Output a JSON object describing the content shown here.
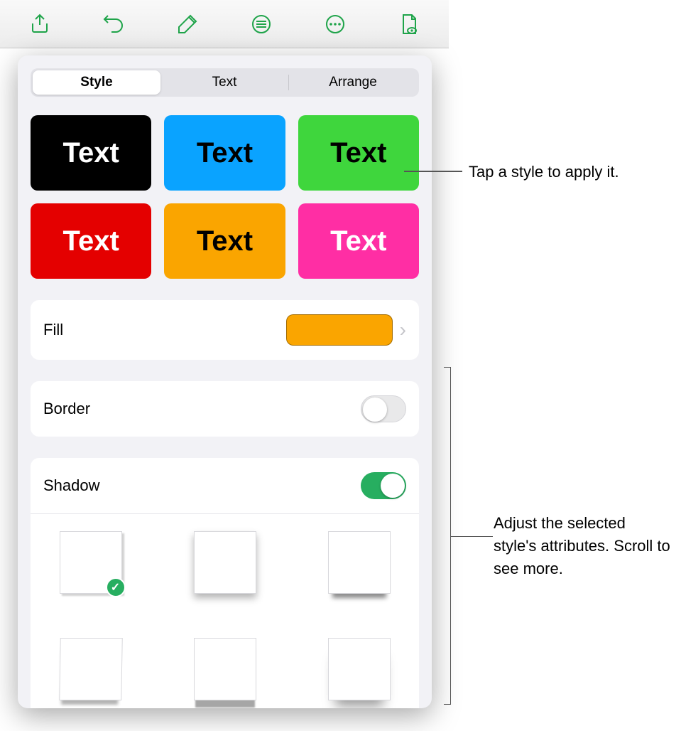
{
  "toolbar": {
    "icons": [
      "share-icon",
      "undo-icon",
      "format-icon",
      "insert-icon",
      "more-icon",
      "document-icon"
    ]
  },
  "segmented": {
    "tabs": [
      {
        "label": "Style",
        "active": true
      },
      {
        "label": "Text",
        "active": false
      },
      {
        "label": "Arrange",
        "active": false
      }
    ]
  },
  "styles": [
    {
      "label": "Text",
      "bg": "#000000",
      "fg": "#ffffff"
    },
    {
      "label": "Text",
      "bg": "#0aa3ff",
      "fg": "#000000"
    },
    {
      "label": "Text",
      "bg": "#3fd63d",
      "fg": "#000000"
    },
    {
      "label": "Text",
      "bg": "#e40000",
      "fg": "#ffffff"
    },
    {
      "label": "Text",
      "bg": "#faa500",
      "fg": "#000000"
    },
    {
      "label": "Text",
      "bg": "#ff2ea4",
      "fg": "#ffffff"
    }
  ],
  "fill": {
    "label": "Fill",
    "color": "#faa500"
  },
  "border": {
    "label": "Border",
    "state": "off"
  },
  "shadow": {
    "label": "Shadow",
    "state": "on",
    "selected_index": 0,
    "options_count": 6
  },
  "callouts": {
    "top": "Tap a style to apply it.",
    "bottom": "Adjust the selected style's attributes. Scroll to see more."
  }
}
